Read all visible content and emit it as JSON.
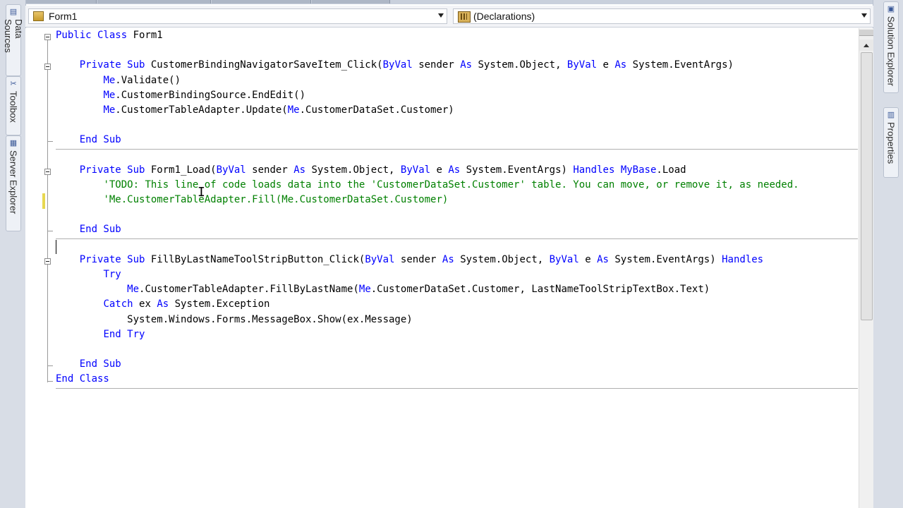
{
  "left_dock": {
    "tabs": [
      {
        "label": "Data Sources",
        "icon": "data-sources-icon"
      },
      {
        "label": "Toolbox",
        "icon": "toolbox-icon"
      },
      {
        "label": "Server Explorer",
        "icon": "server-explorer-icon"
      }
    ]
  },
  "right_dock": {
    "tabs": [
      {
        "label": "Solution Explorer",
        "icon": "solution-explorer-icon"
      },
      {
        "label": "Properties",
        "icon": "properties-icon"
      }
    ]
  },
  "navbar": {
    "class_combo": "Form1",
    "member_combo": "(Declarations)"
  },
  "code": {
    "lines": [
      [
        {
          "t": "Public Class ",
          "k": 1
        },
        {
          "t": "Form1"
        }
      ],
      [],
      [
        {
          "t": "    "
        },
        {
          "t": "Private Sub ",
          "k": 1
        },
        {
          "t": "CustomerBindingNavigatorSaveItem_Click("
        },
        {
          "t": "ByVal",
          "k": 1
        },
        {
          "t": " sender "
        },
        {
          "t": "As",
          "k": 1
        },
        {
          "t": " System.Object, "
        },
        {
          "t": "ByVal",
          "k": 1
        },
        {
          "t": " e "
        },
        {
          "t": "As",
          "k": 1
        },
        {
          "t": " System.EventArgs)"
        }
      ],
      [
        {
          "t": "        "
        },
        {
          "t": "Me",
          "k": 1
        },
        {
          "t": ".Validate()"
        }
      ],
      [
        {
          "t": "        "
        },
        {
          "t": "Me",
          "k": 1
        },
        {
          "t": ".CustomerBindingSource.EndEdit()"
        }
      ],
      [
        {
          "t": "        "
        },
        {
          "t": "Me",
          "k": 1
        },
        {
          "t": ".CustomerTableAdapter.Update("
        },
        {
          "t": "Me",
          "k": 1
        },
        {
          "t": ".CustomerDataSet.Customer)"
        }
      ],
      [],
      [
        {
          "t": "    "
        },
        {
          "t": "End Sub",
          "k": 1
        }
      ],
      [],
      [
        {
          "t": "    "
        },
        {
          "t": "Private Sub ",
          "k": 1
        },
        {
          "t": "Form1_Load("
        },
        {
          "t": "ByVal",
          "k": 1
        },
        {
          "t": " sender "
        },
        {
          "t": "As",
          "k": 1
        },
        {
          "t": " System.Object, "
        },
        {
          "t": "ByVal",
          "k": 1
        },
        {
          "t": " e "
        },
        {
          "t": "As",
          "k": 1
        },
        {
          "t": " System.EventArgs) "
        },
        {
          "t": "Handles",
          "k": 1
        },
        {
          "t": " "
        },
        {
          "t": "MyBase",
          "k": 1
        },
        {
          "t": ".Load"
        }
      ],
      [
        {
          "t": "        "
        },
        {
          "t": "'TODO: This line of code loads data into the 'CustomerDataSet.Customer' table. You can move, or remove it, as needed.",
          "c": 1
        }
      ],
      [
        {
          "t": "        "
        },
        {
          "t": "'Me.CustomerTableAdapter.Fill(Me.CustomerDataSet.Customer)",
          "c": 1
        }
      ],
      [],
      [
        {
          "t": "    "
        },
        {
          "t": "End Sub",
          "k": 1
        }
      ],
      [],
      [
        {
          "t": "    "
        },
        {
          "t": "Private Sub ",
          "k": 1
        },
        {
          "t": "FillByLastNameToolStripButton_Click("
        },
        {
          "t": "ByVal",
          "k": 1
        },
        {
          "t": " sender "
        },
        {
          "t": "As",
          "k": 1
        },
        {
          "t": " System.Object, "
        },
        {
          "t": "ByVal",
          "k": 1
        },
        {
          "t": " e "
        },
        {
          "t": "As",
          "k": 1
        },
        {
          "t": " System.EventArgs) "
        },
        {
          "t": "Handles",
          "k": 1
        }
      ],
      [
        {
          "t": "        "
        },
        {
          "t": "Try",
          "k": 1
        }
      ],
      [
        {
          "t": "            "
        },
        {
          "t": "Me",
          "k": 1
        },
        {
          "t": ".CustomerTableAdapter.FillByLastName("
        },
        {
          "t": "Me",
          "k": 1
        },
        {
          "t": ".CustomerDataSet.Customer, LastNameToolStripTextBox.Text)"
        }
      ],
      [
        {
          "t": "        "
        },
        {
          "t": "Catch",
          "k": 1
        },
        {
          "t": " ex "
        },
        {
          "t": "As",
          "k": 1
        },
        {
          "t": " System.Exception"
        }
      ],
      [
        {
          "t": "            System.Windows.Forms.MessageBox.Show(ex.Message)"
        }
      ],
      [
        {
          "t": "        "
        },
        {
          "t": "End Try",
          "k": 1
        }
      ],
      [],
      [
        {
          "t": "    "
        },
        {
          "t": "End Sub",
          "k": 1
        }
      ],
      [
        {
          "t": "End Class",
          "k": 1
        }
      ]
    ]
  },
  "overflow_glyph": "≡"
}
